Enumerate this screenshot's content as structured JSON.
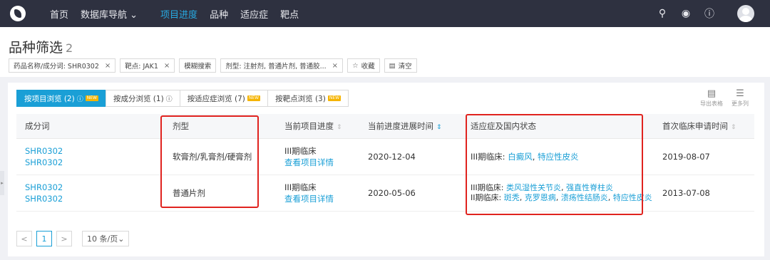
{
  "nav": {
    "items": [
      {
        "label": "首页",
        "active": false
      },
      {
        "label": "数据库导航 ⌄",
        "active": false
      },
      {
        "label": "项目进度",
        "active": true
      },
      {
        "label": "品种",
        "active": false
      },
      {
        "label": "适应症",
        "active": false
      },
      {
        "label": "靶点",
        "active": false
      }
    ],
    "icons": [
      "search-icon",
      "bulb-icon",
      "help-icon",
      "user-avatar"
    ]
  },
  "page": {
    "title": "品种筛选",
    "count": "2"
  },
  "filters": [
    {
      "label": "药品名称/成分词: SHR0302",
      "close": "×"
    },
    {
      "label": "靶点: JAK1",
      "close": "×"
    },
    {
      "label": "模糊搜索",
      "close": ""
    },
    {
      "label": "剂型: 注射剂, 普通片剂, 普通胶...",
      "close": "×"
    }
  ],
  "actions": {
    "favorite": "收藏",
    "clear": "清空"
  },
  "tabs": [
    {
      "label": "按项目浏览 (2)",
      "help": "?",
      "new": "NEW",
      "active": true
    },
    {
      "label": "按成分浏览 (1)",
      "help": "?",
      "new": "",
      "active": false
    },
    {
      "label": "按适应症浏览 (7)",
      "help": "",
      "new": "NEW",
      "active": false
    },
    {
      "label": "按靶点浏览 (3)",
      "help": "",
      "new": "NEW",
      "active": false
    }
  ],
  "tools": {
    "export": "导出表格",
    "more": "更多列"
  },
  "table": {
    "headers": [
      "成分词",
      "剂型",
      "当前项目进度",
      "当前进度进展时间",
      "适应症及国内状态",
      "首次临床申请时间"
    ],
    "rows": [
      {
        "ingredient": [
          "SHR0302",
          "SHR0302"
        ],
        "dosage_form": "软膏剂/乳膏剂/硬膏剂",
        "progress": "III期临床",
        "progress_link": "查看项目详情",
        "progress_date": "2020-12-04",
        "indication_line1_prefix": "III期临床:",
        "indication_line1_links": [
          "白癜风",
          "特应性皮炎"
        ],
        "first_apply": "2019-08-07"
      },
      {
        "ingredient": [
          "SHR0302",
          "SHR0302"
        ],
        "dosage_form": "普通片剂",
        "progress": "III期临床",
        "progress_link": "查看项目详情",
        "progress_date": "2020-05-06",
        "indication_line1_prefix": "III期临床:",
        "indication_line1_links": [
          "类风湿性关节炎",
          "强直性脊柱炎"
        ],
        "indication_line2_prefix": "II期临床:",
        "indication_line2_links": [
          "斑秃",
          "克罗恩病",
          "溃疡性结肠炎",
          "特应性皮炎"
        ],
        "first_apply": "2013-07-08"
      }
    ]
  },
  "pager": {
    "prev": "<",
    "current": "1",
    "next": ">",
    "size": "10 条/页⌄"
  }
}
